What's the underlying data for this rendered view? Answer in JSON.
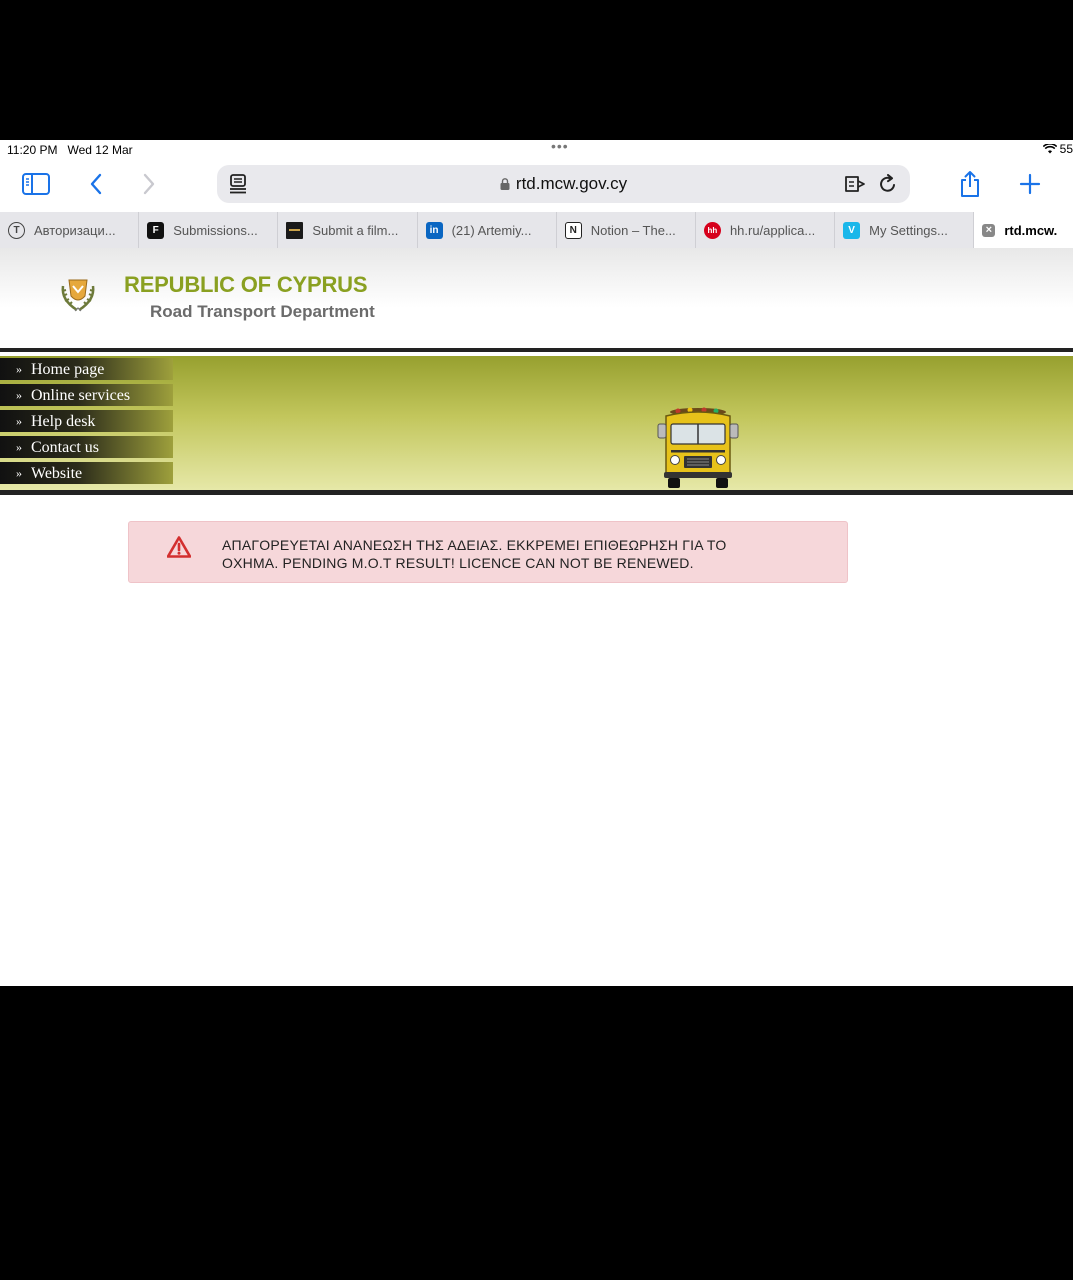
{
  "status_bar": {
    "time": "11:20 PM",
    "date": "Wed 12 Mar",
    "battery": "55"
  },
  "toolbar": {
    "url": "rtd.mcw.gov.cy",
    "icons": [
      "sidebar-icon",
      "back-icon",
      "forward-icon",
      "page-menu-icon",
      "translate-icon",
      "reload-icon",
      "share-icon",
      "new-tab-icon"
    ]
  },
  "tabs": [
    {
      "label": "Авторизаци...",
      "icon_text": "T",
      "icon_color": "#ffffff"
    },
    {
      "label": "Submissions...",
      "icon_text": "F",
      "icon_color": "#111111"
    },
    {
      "label": "Submit a film...",
      "icon_text": "",
      "icon_color": "#1a1a1a"
    },
    {
      "label": "(21) Artemiy...",
      "icon_text": "in",
      "icon_color": "#0a66c2"
    },
    {
      "label": "Notion – The...",
      "icon_text": "N",
      "icon_color": "#ffffff"
    },
    {
      "label": "hh.ru/applica...",
      "icon_text": "hh",
      "icon_color": "#d6001c"
    },
    {
      "label": "My Settings...",
      "icon_text": "V",
      "icon_color": "#1ab7ea"
    },
    {
      "label": "rtd.mcw.",
      "icon_text": "×",
      "icon_color": "#888888"
    }
  ],
  "header": {
    "title": "REPUBLIC OF CYPRUS",
    "subtitle": "Road Transport Department"
  },
  "nav": [
    "Home page",
    "Online services",
    "Help desk",
    "Contact us",
    "Website"
  ],
  "alert": {
    "line1": "ΑΠΑΓΟΡΕΥΕΤΑΙ ΑΝΑΝΕΩΣΗ ΤΗΣ ΑΔΕΙΑΣ. ΕΚΚΡΕΜΕΙ ΕΠΙΘΕΩΡΗΣΗ ΓΙΑ ΤΟ",
    "line2": "ΟΧΗΜΑ. PENDING M.O.T RESULT! LICENCE CAN NOT BE RENEWED."
  },
  "colors": {
    "accent": "#1a73e8",
    "gov_green": "#8aa021",
    "alert_bg": "#f6d7da",
    "alert_red": "#d32f2f"
  }
}
